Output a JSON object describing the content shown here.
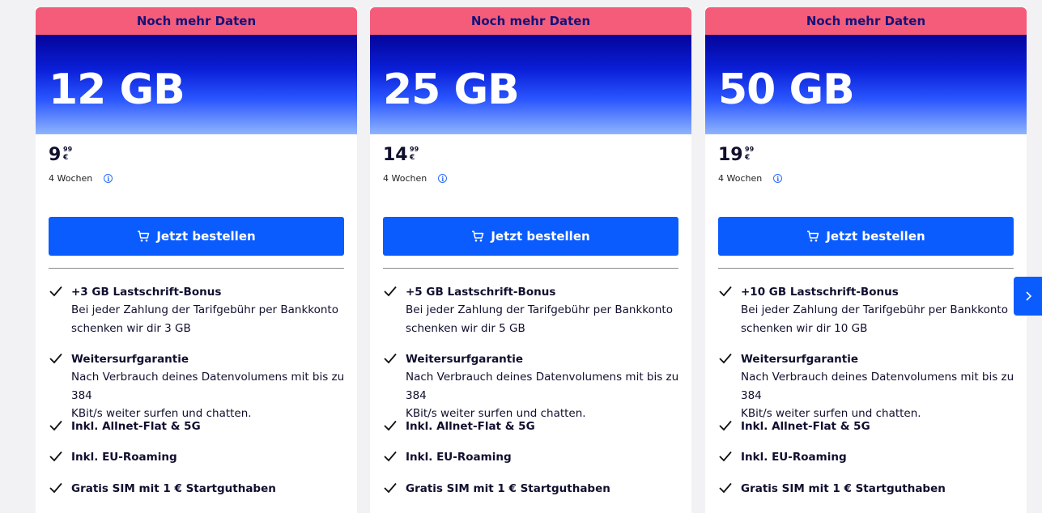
{
  "colors": {
    "badge": "#f45c7a",
    "accent": "#0a5cff",
    "hero_top": "#04049a",
    "hero_bottom": "#8fb4ff"
  },
  "carousel": {
    "next_icon": "chevron-right-icon"
  },
  "cards": [
    {
      "badge": "Noch mehr Daten",
      "data_volume": "12 GB",
      "price_int": "9",
      "price_cents": "99",
      "currency": "€",
      "period": "4 Wochen",
      "order_label": "Jetzt bestellen",
      "features": [
        {
          "title": "+3 GB Lastschrift-Bonus",
          "lines": [
            "Bei jeder Zahlung der Tarifgebühr per Bankkonto",
            "schenken wir dir 3 GB"
          ]
        },
        {
          "title": "Weitersurfgarantie",
          "lines": [
            "Nach Verbrauch deines Datenvolumens mit bis zu 384",
            "KBit/s weiter surfen und chatten."
          ]
        },
        {
          "title": "Inkl. Allnet-Flat & 5G",
          "lines": []
        },
        {
          "title": "Inkl. EU-Roaming",
          "lines": []
        },
        {
          "title": "Gratis SIM mit 1 € Startguthaben",
          "lines": []
        }
      ]
    },
    {
      "badge": "Noch mehr Daten",
      "data_volume": "25 GB",
      "price_int": "14",
      "price_cents": "99",
      "currency": "€",
      "period": "4 Wochen",
      "order_label": "Jetzt bestellen",
      "features": [
        {
          "title": "+5 GB Lastschrift-Bonus",
          "lines": [
            "Bei jeder Zahlung der Tarifgebühr per Bankkonto",
            "schenken wir dir 5 GB"
          ]
        },
        {
          "title": "Weitersurfgarantie",
          "lines": [
            "Nach Verbrauch deines Datenvolumens mit bis zu 384",
            "KBit/s weiter surfen und chatten."
          ]
        },
        {
          "title": "Inkl. Allnet-Flat & 5G",
          "lines": []
        },
        {
          "title": "Inkl. EU-Roaming",
          "lines": []
        },
        {
          "title": "Gratis SIM mit 1 € Startguthaben",
          "lines": []
        }
      ]
    },
    {
      "badge": "Noch mehr Daten",
      "data_volume": "50 GB",
      "price_int": "19",
      "price_cents": "99",
      "currency": "€",
      "period": "4 Wochen",
      "order_label": "Jetzt bestellen",
      "features": [
        {
          "title": "+10 GB Lastschrift-Bonus",
          "lines": [
            "Bei jeder Zahlung der Tarifgebühr per Bankkonto",
            "schenken wir dir 10 GB"
          ]
        },
        {
          "title": "Weitersurfgarantie",
          "lines": [
            "Nach Verbrauch deines Datenvolumens mit bis zu 384",
            "KBit/s weiter surfen und chatten."
          ]
        },
        {
          "title": "Inkl. Allnet-Flat & 5G",
          "lines": []
        },
        {
          "title": "Inkl. EU-Roaming",
          "lines": []
        },
        {
          "title": "Gratis SIM mit 1 € Startguthaben",
          "lines": []
        }
      ]
    }
  ]
}
